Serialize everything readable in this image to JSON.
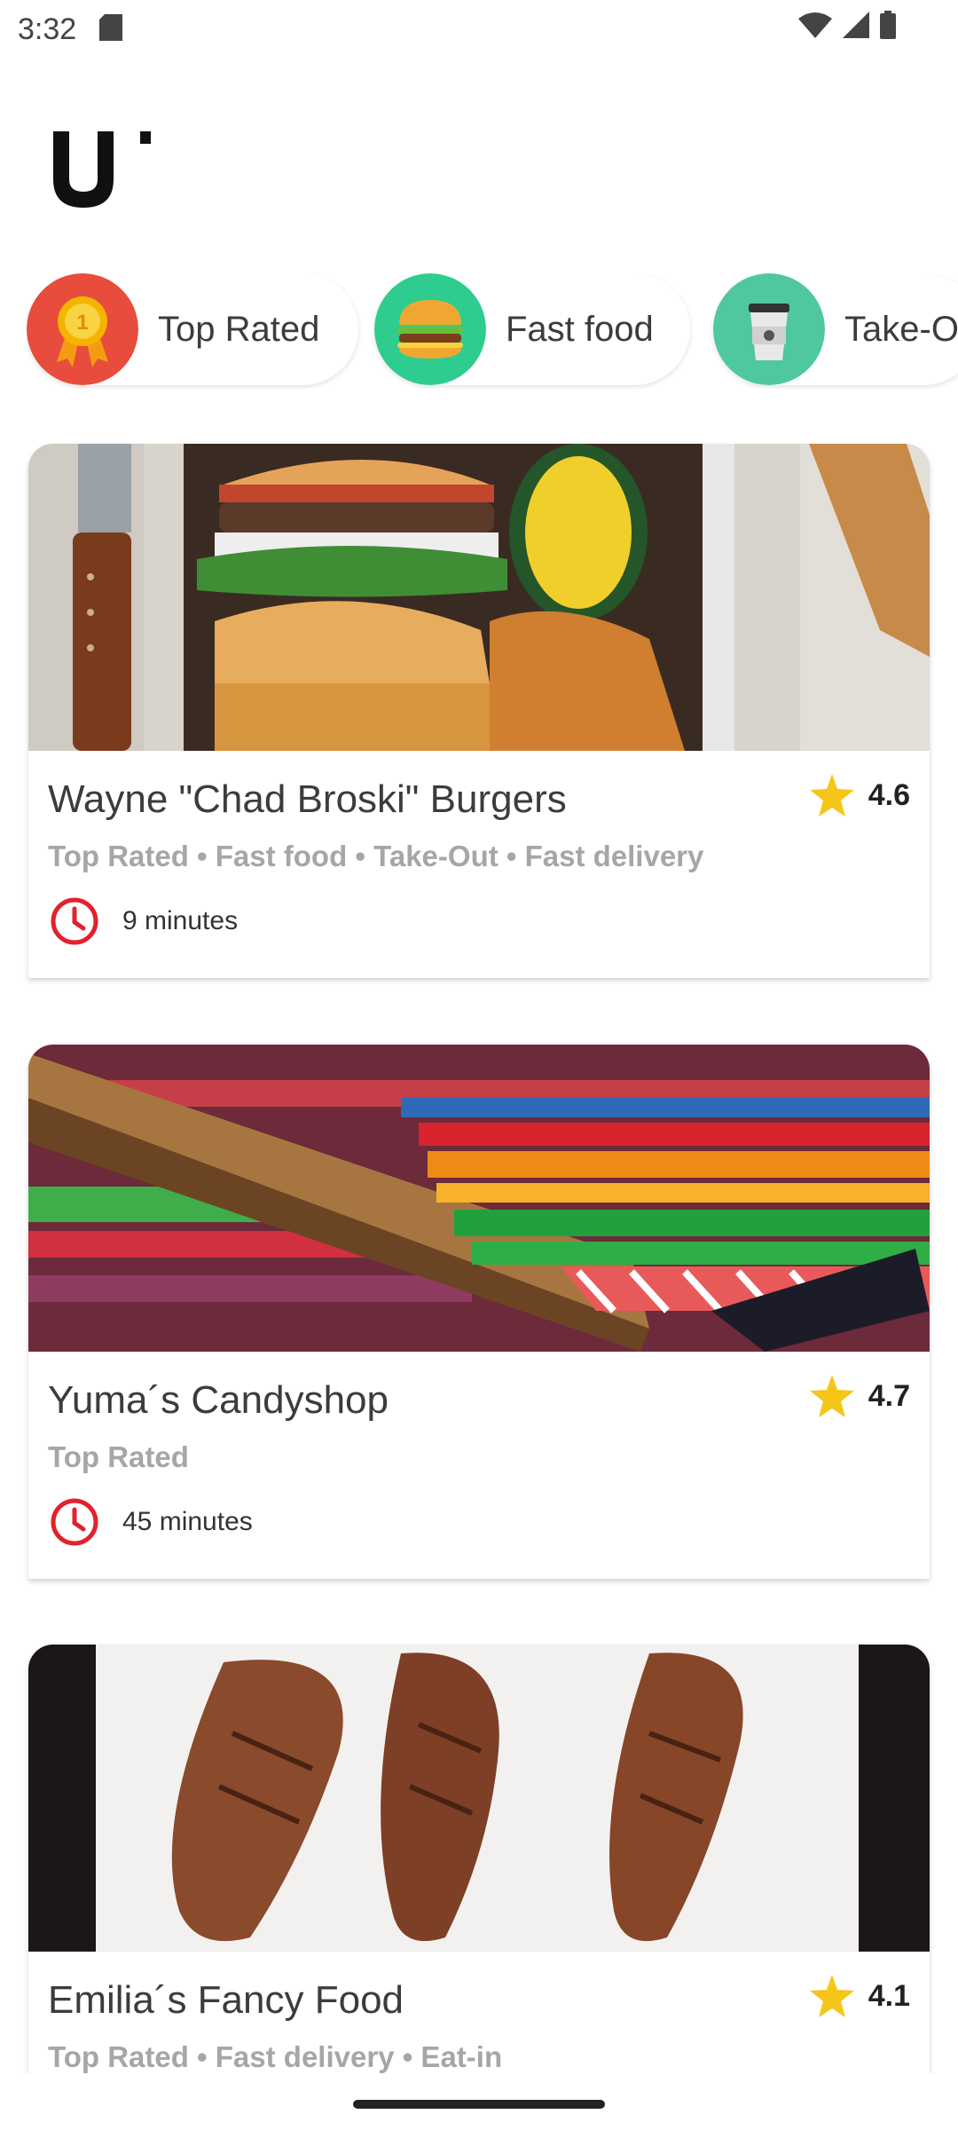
{
  "status_bar": {
    "time": "3:32"
  },
  "categories": [
    {
      "label": "Top Rated",
      "icon": "medal-icon",
      "color": "#e74c3c"
    },
    {
      "label": "Fast food",
      "icon": "burger-icon",
      "color": "#2ecc8f"
    },
    {
      "label": "Take-O",
      "icon": "coffee-cup-icon",
      "color": "#4fc7a0"
    }
  ],
  "restaurants": [
    {
      "name": "Wayne \"Chad Broski\" Burgers",
      "rating": "4.6",
      "tags": "Top Rated • Fast food • Take-Out • Fast delivery",
      "time": "9 minutes",
      "image": "burger-photo"
    },
    {
      "name": "Yuma´s Candyshop",
      "rating": "4.7",
      "tags": "Top Rated",
      "time": "45 minutes",
      "image": "candy-photo"
    },
    {
      "name": "Emilia´s Fancy Food",
      "rating": "4.1",
      "tags": "Top Rated • Fast delivery • Eat-in",
      "time": "",
      "image": "steak-photo"
    }
  ],
  "colors": {
    "star": "#f5c518",
    "clock": "#e3202c",
    "tag": "#a6a6a6"
  }
}
